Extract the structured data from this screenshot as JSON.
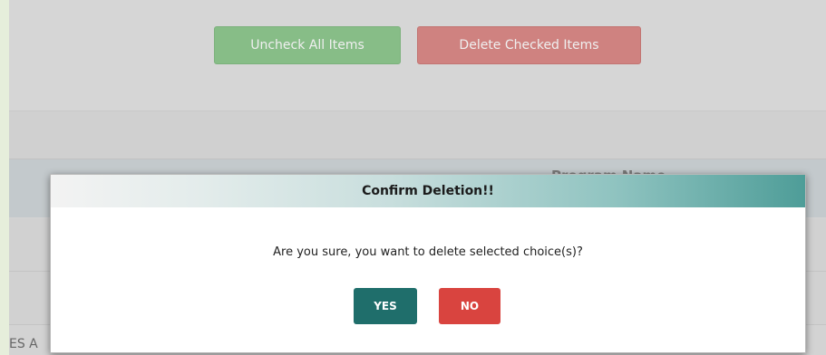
{
  "toolbar": {
    "uncheck_label": "Uncheck All Items",
    "delete_label": "Delete Checked Items"
  },
  "table": {
    "column_program": "Program Name"
  },
  "footer": {
    "partial_text": "ES A"
  },
  "dialog": {
    "title": "Confirm Deletion!!",
    "message": "Are you sure, you want to delete selected choice(s)?",
    "yes_label": "YES",
    "no_label": "NO"
  },
  "colors": {
    "yes_button": "#1f6e6b",
    "no_button": "#d9443f",
    "header_gradient_end": "#4e9d98"
  }
}
